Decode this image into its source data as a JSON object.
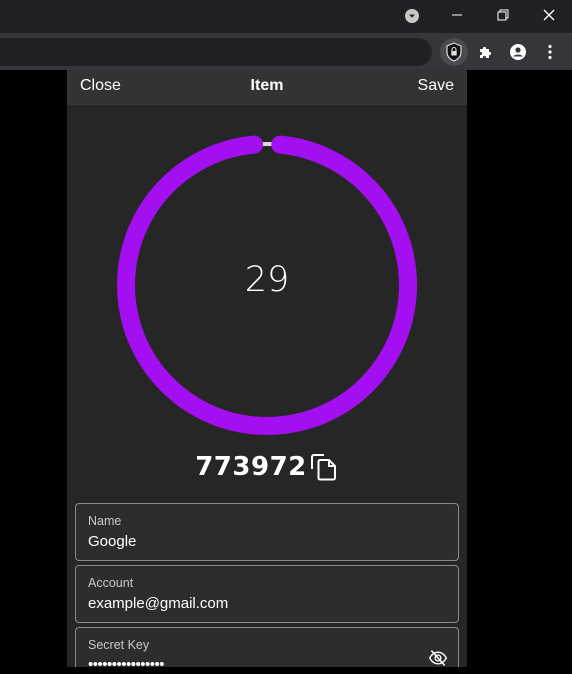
{
  "window": {
    "minimize_glyph": "—",
    "restore_glyph": "⧉",
    "close_glyph": "✕"
  },
  "extensions": [
    "authenticator-extension-icon",
    "puzzle-icon",
    "profile-icon",
    "kebab-menu-icon"
  ],
  "header": {
    "close_label": "Close",
    "title": "Item",
    "save_label": "Save"
  },
  "timer": {
    "seconds_remaining": "29",
    "progress": 0.97,
    "ring_color": "#a30ff0"
  },
  "otp": {
    "code": "773972"
  },
  "fields": {
    "name": {
      "label": "Name",
      "value": "Google"
    },
    "account": {
      "label": "Account",
      "value": "example@gmail.com"
    },
    "secret": {
      "label": "Secret Key",
      "value": "••••••••••••••••"
    }
  }
}
